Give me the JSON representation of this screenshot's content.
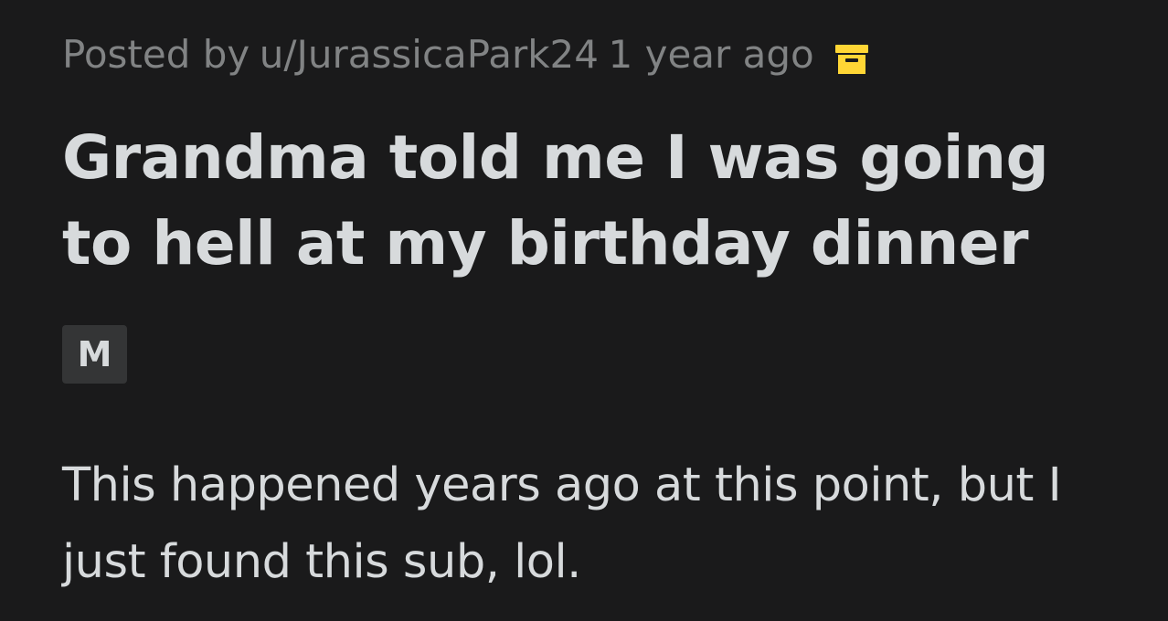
{
  "post": {
    "meta": {
      "posted_by_prefix": "Posted by",
      "username": "u/JurassicaPark24",
      "time_ago": "1 year ago",
      "archived_icon": "archive-box-icon",
      "archived_icon_color": "#ffd635"
    },
    "title": "Grandma told me I was going to hell at my birthday dinner",
    "flair": {
      "label": "M",
      "background_color": "#343536"
    },
    "body": "This happened years ago at this point, but I just found this sub, lol."
  },
  "colors": {
    "background": "#1a1a1b",
    "meta_text": "#818384",
    "primary_text": "#d7dadc"
  }
}
